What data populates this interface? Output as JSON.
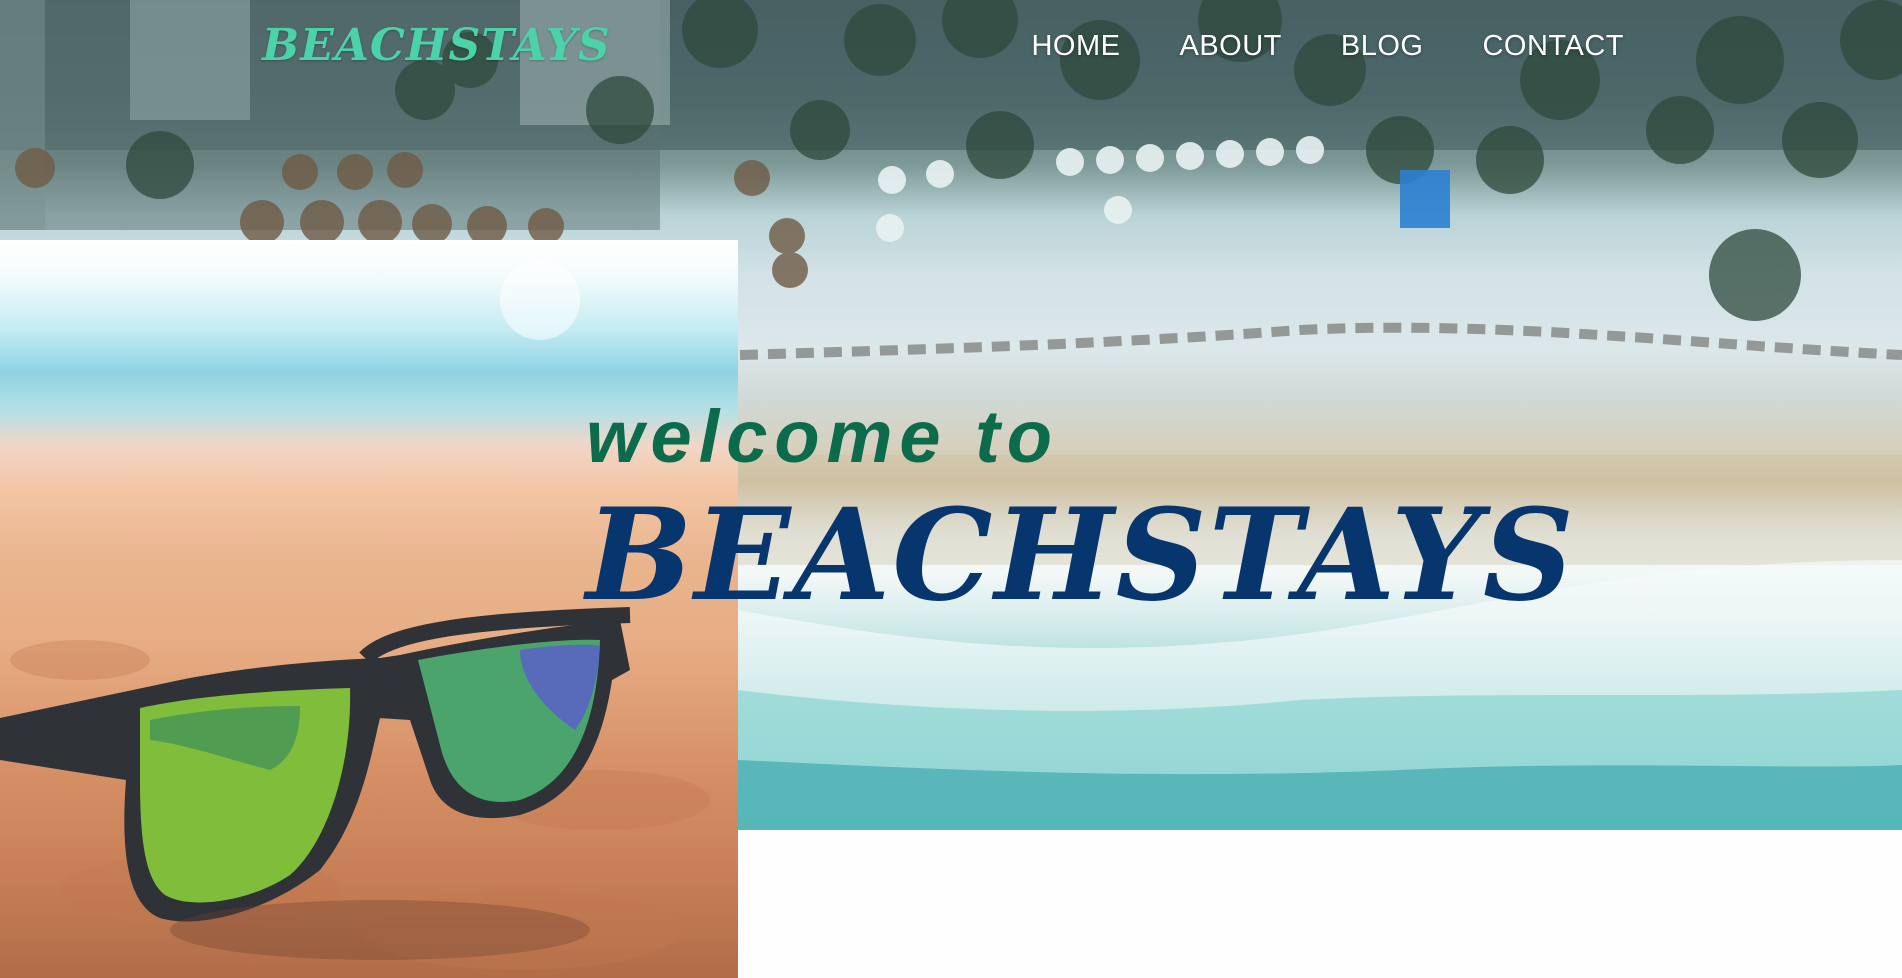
{
  "header": {
    "logo": "BEACHSTAYS",
    "nav": [
      {
        "label": "HOME"
      },
      {
        "label": "ABOUT"
      },
      {
        "label": "BLOG"
      },
      {
        "label": "CONTACT"
      }
    ]
  },
  "hero": {
    "welcome": "welcome to",
    "title": "BEACHSTAYS"
  },
  "colors": {
    "logo": "#4bd2a8",
    "nav_text": "#ffffff",
    "welcome_text": "#0b6b4b",
    "title_text": "#07366f",
    "page_background": "#fdfefd"
  },
  "images": {
    "aerial": "aerial-beach-photo",
    "left": "sunglasses-on-sand-photo"
  }
}
